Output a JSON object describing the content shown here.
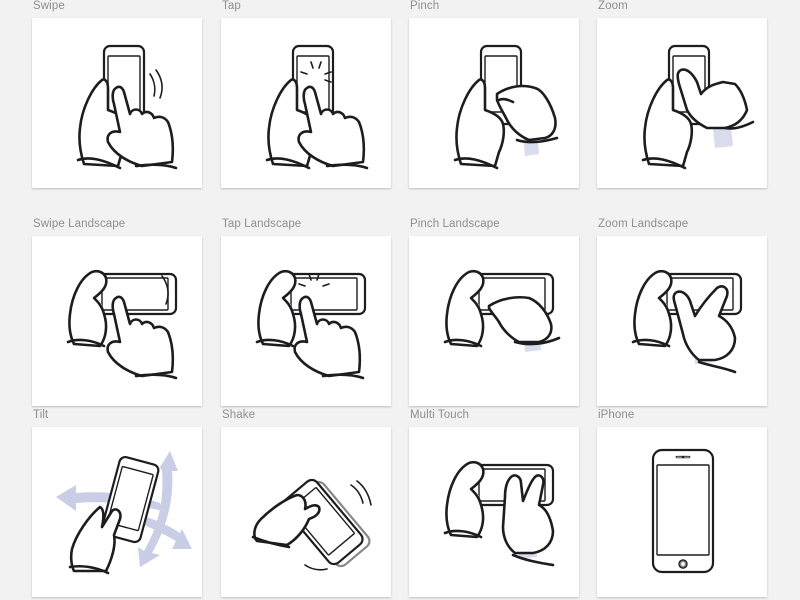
{
  "gestures": [
    {
      "label": "Swipe",
      "icon": "swipe-gesture-icon"
    },
    {
      "label": "Tap",
      "icon": "tap-gesture-icon"
    },
    {
      "label": "Pinch",
      "icon": "pinch-gesture-icon"
    },
    {
      "label": "Zoom",
      "icon": "zoom-gesture-icon"
    },
    {
      "label": "Swipe Landscape",
      "icon": "swipe-landscape-gesture-icon"
    },
    {
      "label": "Tap Landscape",
      "icon": "tap-landscape-gesture-icon"
    },
    {
      "label": "Pinch Landscape",
      "icon": "pinch-landscape-gesture-icon"
    },
    {
      "label": "Zoom Landscape",
      "icon": "zoom-landscape-gesture-icon"
    },
    {
      "label": "Tilt",
      "icon": "tilt-gesture-icon"
    },
    {
      "label": "Shake",
      "icon": "shake-gesture-icon"
    },
    {
      "label": "Multi Touch",
      "icon": "multi-touch-gesture-icon"
    },
    {
      "label": "iPhone",
      "icon": "iphone-device-icon"
    }
  ],
  "colors": {
    "background": "#f2f2f2",
    "card": "#ffffff",
    "label": "#8e8e8e",
    "ink": "#1d1d1f",
    "shade": "#d9dced"
  }
}
